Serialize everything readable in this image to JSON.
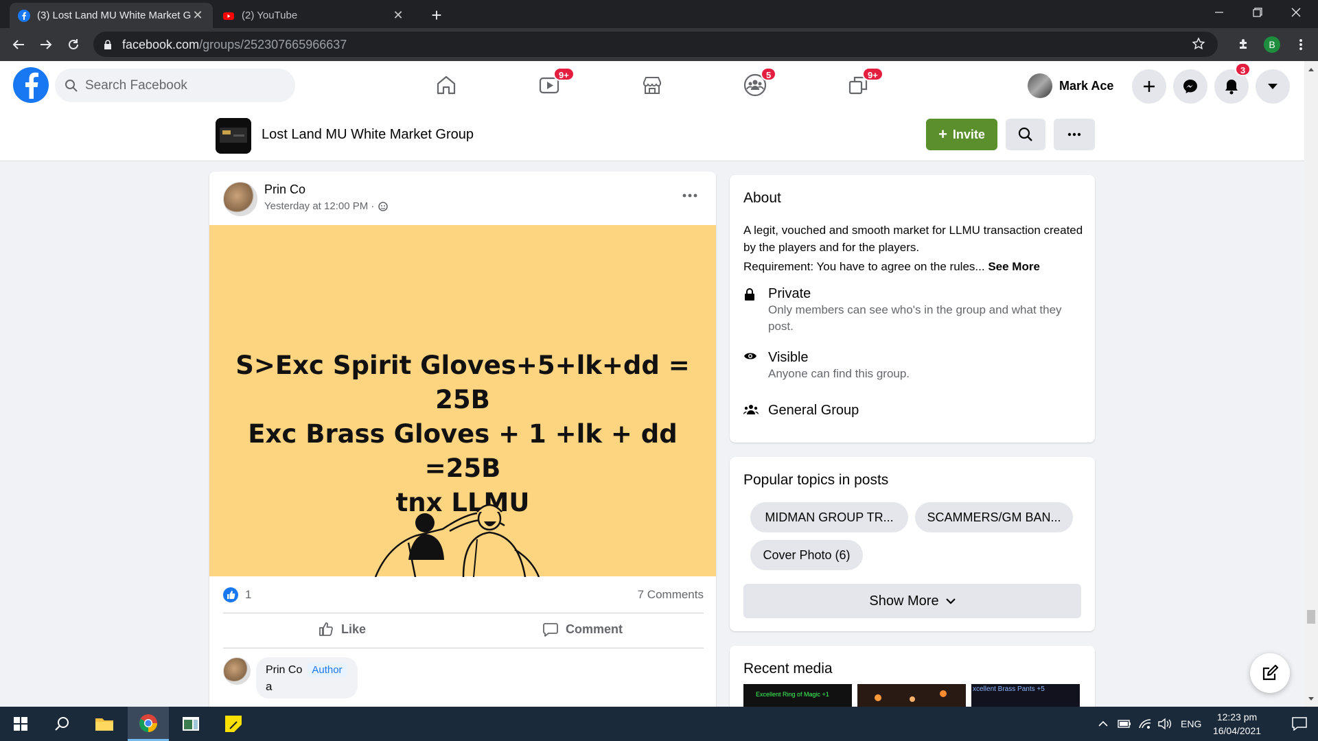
{
  "browser": {
    "tabs": [
      {
        "title": "(3) Lost Land MU White Market G",
        "active": true
      },
      {
        "title": "(2) YouTube",
        "active": false
      }
    ],
    "url_host": "facebook.com",
    "url_path": "/groups/252307665966637",
    "profile_letter": "B"
  },
  "fb": {
    "search_placeholder": "Search Facebook",
    "badges": {
      "watch": "9+",
      "groups": "5",
      "gaming": "9+",
      "notifications": "3"
    },
    "user_name": "Mark Ace"
  },
  "group": {
    "name": "Lost Land MU White Market Group",
    "invite_label": "Invite"
  },
  "post": {
    "author": "Prin Co",
    "time": "Yesterday at 12:00 PM ·",
    "image_text_lines": [
      "S>Exc Spirit Gloves+5+lk+dd = 25B",
      "Exc Brass Gloves + 1 +lk + dd =25B",
      "tnx LLMU"
    ],
    "reaction_count": "1",
    "comments_count": "7 Comments",
    "like_label": "Like",
    "comment_label": "Comment",
    "comment": {
      "author": "Prin Co",
      "author_badge": "Author",
      "text": "a"
    }
  },
  "about": {
    "title": "About",
    "description": "A legit, vouched and smooth market for LLMU transaction created by the players and for the players.",
    "requirement": "Requirement: You have to agree on the rules...",
    "see_more": "See More",
    "private_title": "Private",
    "private_desc": "Only members can see who's in the group and what they post.",
    "visible_title": "Visible",
    "visible_desc": "Anyone can find this group.",
    "general_title": "General Group"
  },
  "topics": {
    "title": "Popular topics in posts",
    "chips": [
      "MIDMAN GROUP TR...",
      "SCAMMERS/GM BAN...",
      "Cover Photo (6)"
    ],
    "show_more": "Show More"
  },
  "media": {
    "title": "Recent media",
    "captions": [
      "Excellent Ring of Magic +1",
      "",
      "xcellent Brass Pants +5"
    ]
  },
  "taskbar": {
    "lang": "ENG",
    "time": "12:23 pm",
    "date": "16/04/2021"
  },
  "colors": {
    "fb_blue": "#1877f2",
    "invite_green": "#5a8f2c",
    "badge_red": "#e41e3f",
    "post_bg": "#fdd47f"
  }
}
